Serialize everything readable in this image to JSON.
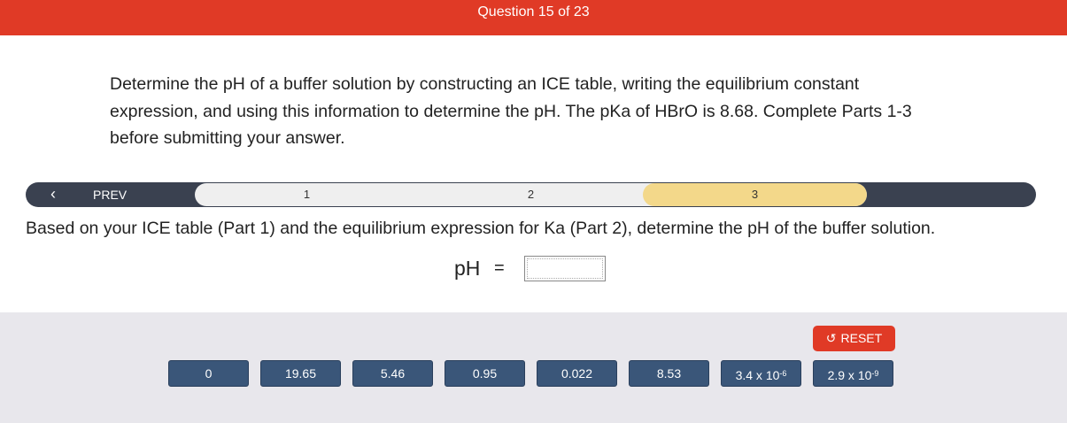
{
  "header": {
    "title": "Question 15 of 23"
  },
  "prompt": "Determine the pH of a buffer solution by constructing an ICE table, writing the equilibrium constant expression, and using this information to determine the pH. The pKa of HBrO is 8.68. Complete Parts 1-3 before submitting your answer.",
  "nav": {
    "prev_label": "PREV",
    "steps": [
      "1",
      "2",
      "3"
    ],
    "active_step": "3"
  },
  "question": "Based on your ICE table (Part 1) and the equilibrium expression for Ka (Part 2), determine the pH of the buffer solution.",
  "answer": {
    "label": "pH",
    "equals": "=",
    "value": ""
  },
  "reset_label": "RESET",
  "tiles": [
    {
      "label": "0",
      "exp": ""
    },
    {
      "label": "19.65",
      "exp": ""
    },
    {
      "label": "5.46",
      "exp": ""
    },
    {
      "label": "0.95",
      "exp": ""
    },
    {
      "label": "0.022",
      "exp": ""
    },
    {
      "label": "8.53",
      "exp": ""
    },
    {
      "label": "3.4 x 10",
      "exp": "-6"
    },
    {
      "label": "2.9 x 10",
      "exp": "-9"
    }
  ],
  "colors": {
    "header": "#e03a26",
    "nav": "#3a4150",
    "active_step": "#f3d88a",
    "tile": "#3a5679",
    "tray": "#e8e7ec"
  }
}
